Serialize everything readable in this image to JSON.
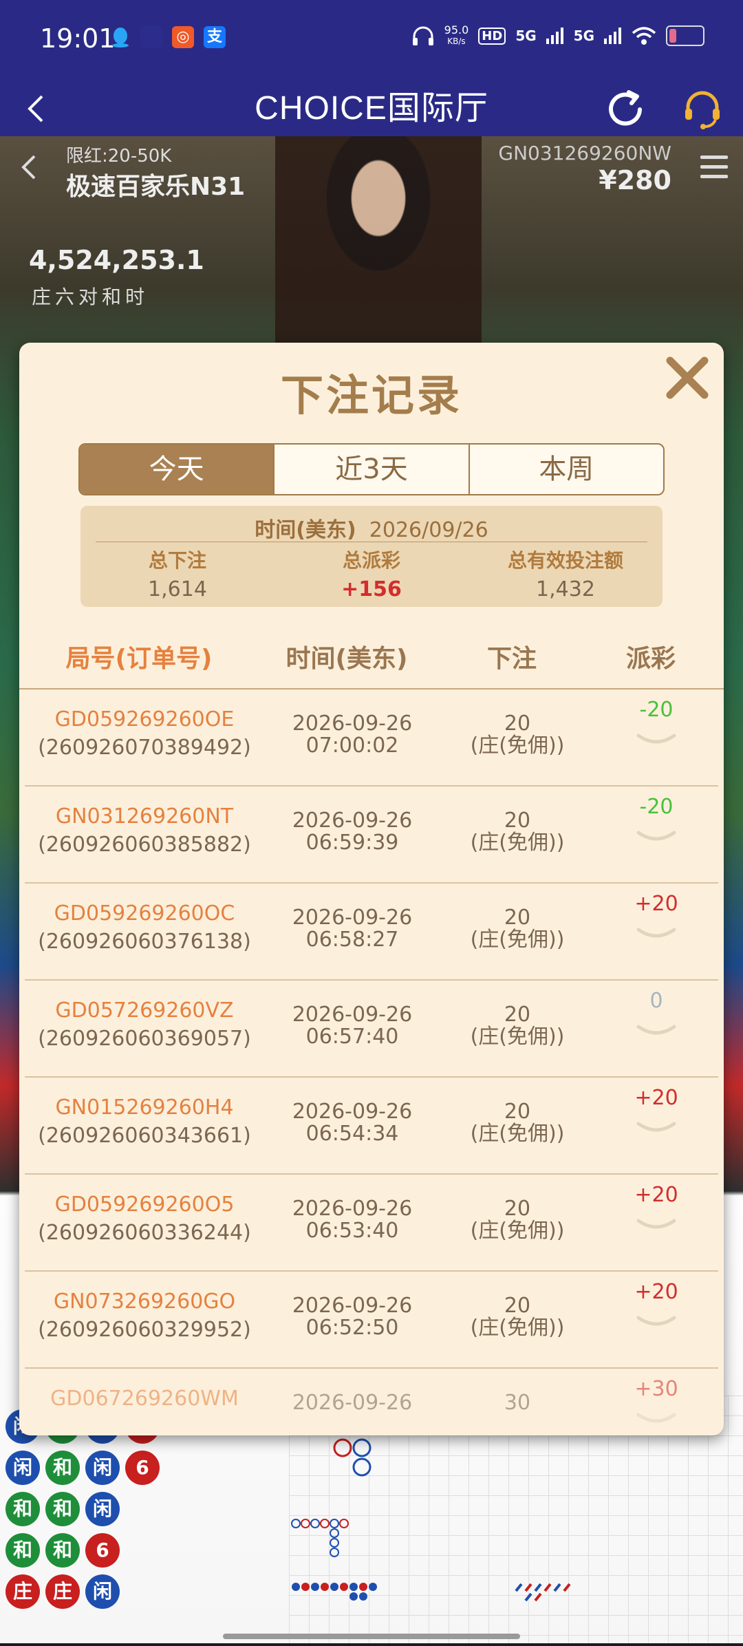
{
  "status_bar": {
    "time": "19:01",
    "net_speed_value": "95.0",
    "net_speed_unit": "KB/s",
    "hd_label": "HD",
    "signal1": "5G",
    "signal2": "5G"
  },
  "header": {
    "title": "CHOICE国际厅"
  },
  "game": {
    "limit": "限红:20-50K",
    "table_name": "极速百家乐N31",
    "round_code": "GN031269260NW",
    "balance": "¥280",
    "jackpot": "4,524,253.1",
    "side_bets": "庄六对和时",
    "bead_road": [
      [
        "闲",
        "和",
        "闲",
        "庄"
      ],
      [
        "闲",
        "和",
        "闲",
        "6"
      ],
      [
        "和",
        "和",
        "闲",
        ""
      ],
      [
        "和",
        "和",
        "6",
        ""
      ],
      [
        "庄",
        "庄",
        "闲",
        ""
      ]
    ]
  },
  "modal": {
    "title": "下注记录",
    "tabs": [
      {
        "label": "今天",
        "active": true
      },
      {
        "label": "近3天",
        "active": false
      },
      {
        "label": "本周",
        "active": false
      }
    ],
    "summary": {
      "date_label": "时间(美东)",
      "date": "2026/09/26",
      "total_bet_label": "总下注",
      "total_bet": "1,614",
      "total_payout_label": "总派彩",
      "total_payout": "+156",
      "total_valid_label": "总有效投注额",
      "total_valid": "1,432"
    },
    "columns": {
      "id_main": "局号",
      "id_sub": "(订单号)",
      "time": "时间(美东)",
      "bet": "下注",
      "payout": "派彩"
    },
    "rows": [
      {
        "code": "GD059269260OE",
        "order": "(260926070389492)",
        "date": "2026-09-26",
        "time": "07:00:02",
        "amount": "20",
        "bet_type": "(庄(免佣))",
        "payout": "-20"
      },
      {
        "code": "GN031269260NT",
        "order": "(260926060385882)",
        "date": "2026-09-26",
        "time": "06:59:39",
        "amount": "20",
        "bet_type": "(庄(免佣))",
        "payout": "-20"
      },
      {
        "code": "GD059269260OC",
        "order": "(260926060376138)",
        "date": "2026-09-26",
        "time": "06:58:27",
        "amount": "20",
        "bet_type": "(庄(免佣))",
        "payout": "+20"
      },
      {
        "code": "GD057269260VZ",
        "order": "(260926060369057)",
        "date": "2026-09-26",
        "time": "06:57:40",
        "amount": "20",
        "bet_type": "(庄(免佣))",
        "payout": "0"
      },
      {
        "code": "GN015269260H4",
        "order": "(260926060343661)",
        "date": "2026-09-26",
        "time": "06:54:34",
        "amount": "20",
        "bet_type": "(庄(免佣))",
        "payout": "+20"
      },
      {
        "code": "GD059269260O5",
        "order": "(260926060336244)",
        "date": "2026-09-26",
        "time": "06:53:40",
        "amount": "20",
        "bet_type": "(庄(免佣))",
        "payout": "+20"
      },
      {
        "code": "GN073269260GO",
        "order": "(260926060329952)",
        "date": "2026-09-26",
        "time": "06:52:50",
        "amount": "20",
        "bet_type": "(庄(免佣))",
        "payout": "+20"
      },
      {
        "code": "GD067269260WM",
        "order": "",
        "date": "2026-09-26",
        "time": "",
        "amount": "30",
        "bet_type": "",
        "payout": "+30"
      }
    ]
  }
}
